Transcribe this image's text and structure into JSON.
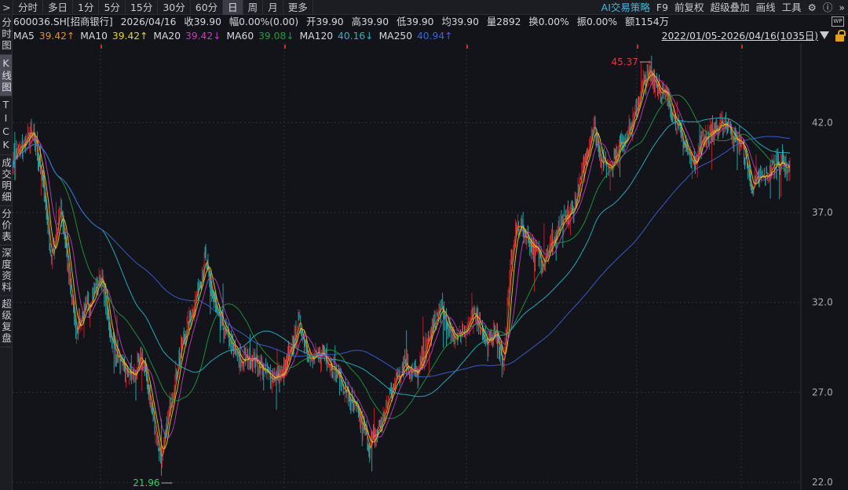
{
  "toolbar": {
    "expand": ">",
    "tabs": [
      "分时",
      "多日",
      "1分",
      "5分",
      "15分",
      "30分",
      "60分",
      "日",
      "周",
      "月",
      "更多"
    ],
    "active": "日",
    "right": {
      "ai": "AI交易策略",
      "f9": "F9",
      "adjust": "前复权",
      "overlay": "超级叠加",
      "draw": "画线",
      "tools": "工具",
      "more": "»"
    }
  },
  "info": {
    "code": "600036.SH[招商银行]",
    "date": "2026/04/16",
    "close": "收39.90",
    "change": "幅0.00%(0.00)",
    "open": "开39.90",
    "high": "高39.90",
    "low": "低39.90",
    "avg": "均39.90",
    "volume": "量2892",
    "turnover": "换0.00%",
    "amplitude": "振0.00%",
    "amount": "额1154万"
  },
  "ma": [
    {
      "label": "MA5",
      "value": "39.42↑",
      "color": "#f08a1c"
    },
    {
      "label": "MA10",
      "value": "39.42↑",
      "color": "#e8d22a"
    },
    {
      "label": "MA20",
      "value": "39.42↓",
      "color": "#c23bc2"
    },
    {
      "label": "MA60",
      "value": "39.08↓",
      "color": "#1f9a3c"
    },
    {
      "label": "MA120",
      "value": "40.16↓",
      "color": "#26b6c8"
    },
    {
      "label": "MA250",
      "value": "40.94↑",
      "color": "#3a64d8"
    }
  ],
  "range": "2022/01/05-2026/04/16(1035日)",
  "wp": "WP",
  "sidebar": [
    "分时图",
    "K线图",
    "TICK",
    "成交明细",
    "分价表",
    "深度资料",
    "超级复盘"
  ],
  "sidebar_active": "K线图",
  "chart_data": {
    "type": "candlestick",
    "days": 1035,
    "y_ticks": [
      22.0,
      27.0,
      32.0,
      37.0,
      42.0
    ],
    "ylim": [
      21.7,
      46.2
    ],
    "up_color": "#e0262b",
    "down_color": "#29c7cc",
    "max_label": "45.37",
    "min_label": "21.96",
    "close_path": [
      [
        0,
        39.9
      ],
      [
        10,
        40.5
      ],
      [
        24,
        41.4
      ],
      [
        31,
        40.8
      ],
      [
        42,
        38.2
      ],
      [
        52,
        34.3
      ],
      [
        63,
        37.3
      ],
      [
        73,
        34.3
      ],
      [
        84,
        30.5
      ],
      [
        99,
        31.7
      ],
      [
        118,
        33.5
      ],
      [
        131,
        30.0
      ],
      [
        146,
        28.3
      ],
      [
        162,
        27.9
      ],
      [
        172,
        29.0
      ],
      [
        183,
        26.6
      ],
      [
        198,
        23.2
      ],
      [
        209,
        26.2
      ],
      [
        225,
        29.6
      ],
      [
        240,
        31.7
      ],
      [
        256,
        34.3
      ],
      [
        272,
        31.3
      ],
      [
        287,
        30.0
      ],
      [
        303,
        28.7
      ],
      [
        319,
        29.0
      ],
      [
        339,
        27.9
      ],
      [
        360,
        27.9
      ],
      [
        381,
        30.9
      ],
      [
        397,
        28.7
      ],
      [
        413,
        29.2
      ],
      [
        428,
        28.3
      ],
      [
        444,
        27.0
      ],
      [
        460,
        25.7
      ],
      [
        475,
        24.0
      ],
      [
        491,
        25.3
      ],
      [
        507,
        27.5
      ],
      [
        522,
        28.7
      ],
      [
        538,
        27.9
      ],
      [
        554,
        30.0
      ],
      [
        569,
        31.7
      ],
      [
        585,
        30.0
      ],
      [
        601,
        30.5
      ],
      [
        616,
        31.3
      ],
      [
        632,
        29.6
      ],
      [
        642,
        30.5
      ],
      [
        653,
        28.5
      ],
      [
        663,
        34.3
      ],
      [
        672,
        36.5
      ],
      [
        684,
        35.6
      ],
      [
        705,
        34.3
      ],
      [
        726,
        36.0
      ],
      [
        747,
        37.3
      ],
      [
        762,
        39.9
      ],
      [
        773,
        42.0
      ],
      [
        783,
        39.9
      ],
      [
        794,
        39.5
      ],
      [
        809,
        40.8
      ],
      [
        825,
        42.0
      ],
      [
        839,
        44.2
      ],
      [
        849,
        44.8
      ],
      [
        862,
        43.8
      ],
      [
        872,
        43.3
      ],
      [
        883,
        42.0
      ],
      [
        893,
        40.8
      ],
      [
        906,
        39.7
      ],
      [
        919,
        41.2
      ],
      [
        935,
        41.6
      ],
      [
        950,
        42.0
      ],
      [
        961,
        41.0
      ],
      [
        971,
        40.8
      ],
      [
        982,
        38.4
      ],
      [
        992,
        38.8
      ],
      [
        1003,
        39.0
      ],
      [
        1018,
        39.9
      ],
      [
        1034,
        39.5
      ]
    ]
  }
}
